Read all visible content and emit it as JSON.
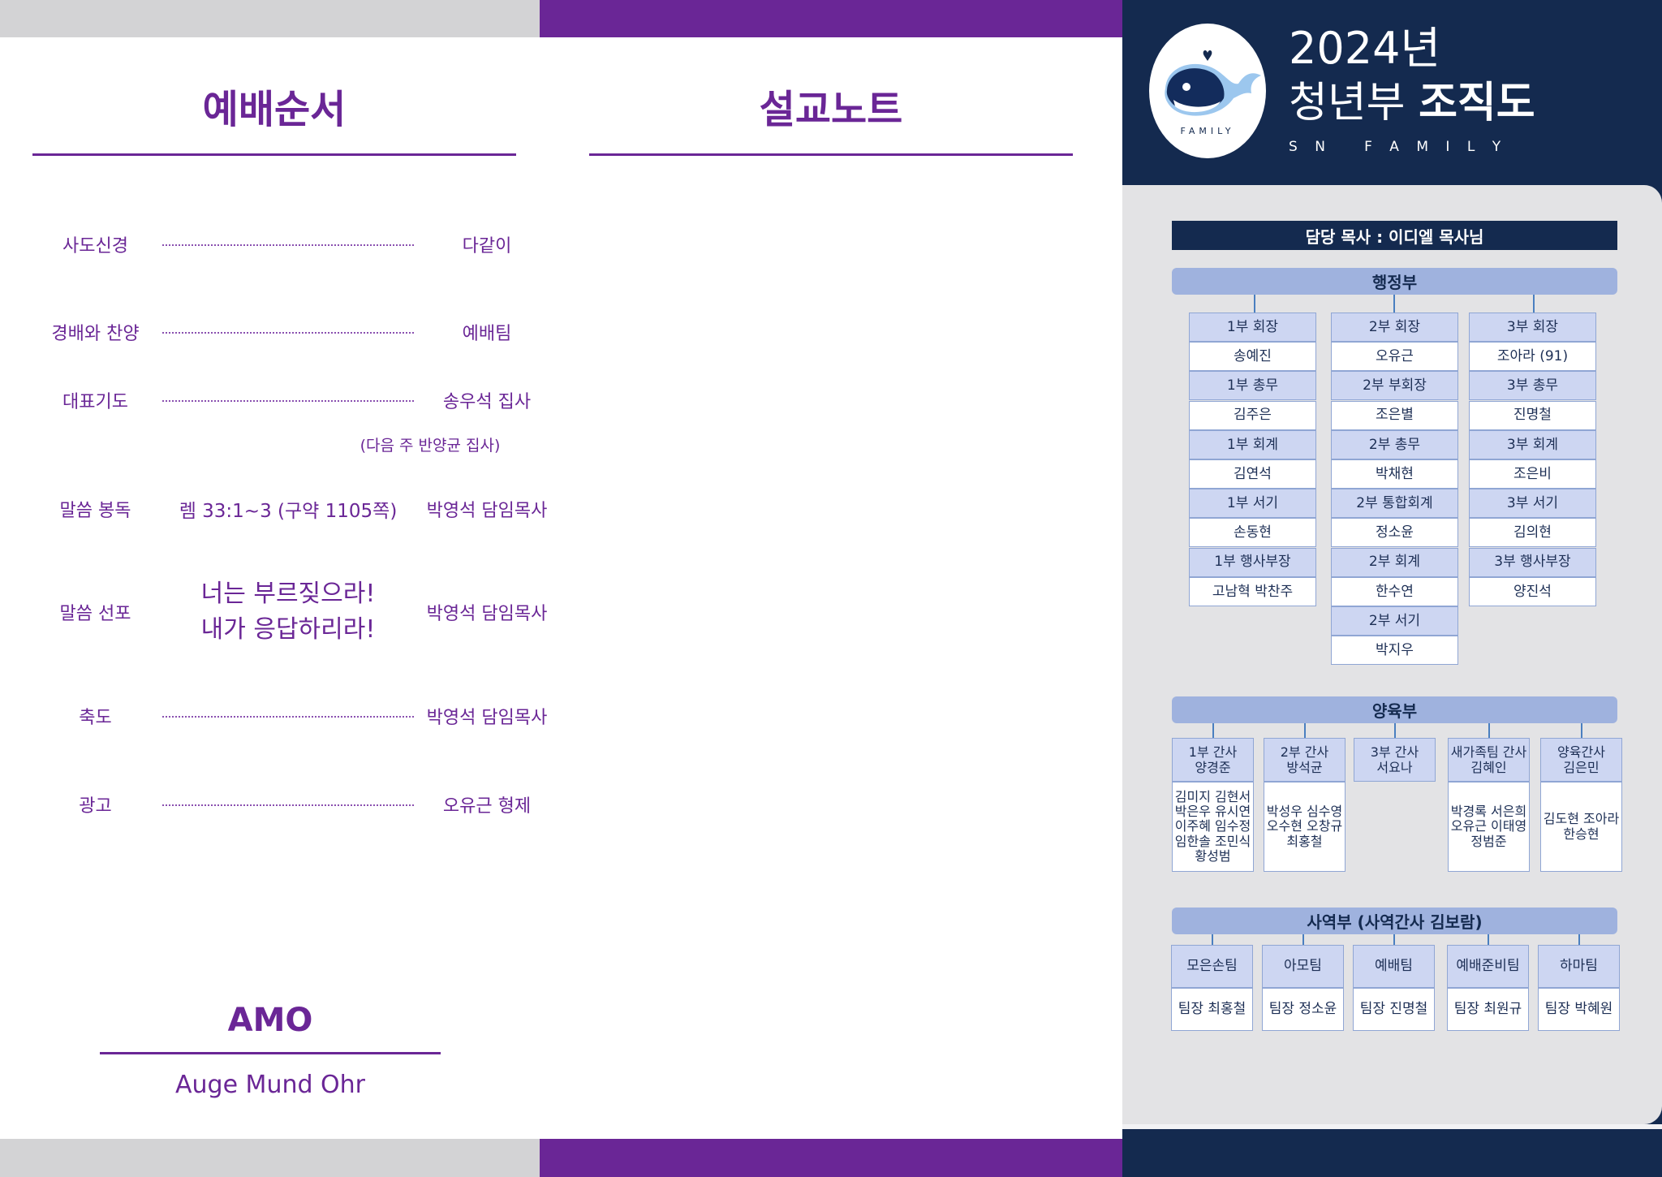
{
  "left": {
    "title": "예배순서",
    "items": [
      {
        "label": "사도신경",
        "right": "다같이"
      },
      {
        "label": "경배와 찬양",
        "right": "예배팀"
      },
      {
        "label": "대표기도",
        "right": "송우석 집사",
        "note": "(다음 주 반양균 집사)"
      },
      {
        "label": "말씀 봉독",
        "middle": "렘 33:1~3 (구약 1105쪽)",
        "right": "박영석 담임목사"
      },
      {
        "label": "말씀 선포",
        "middle_line1": "너는 부르짖으라!",
        "middle_line2": "내가 응답하리라!",
        "right": "박영석 담임목사"
      },
      {
        "label": "축도",
        "right": "박영석 담임목사"
      },
      {
        "label": "광고",
        "right": "오유근 형제"
      }
    ],
    "footer": {
      "title": "AMO",
      "subtitle": "Auge Mund Ohr"
    }
  },
  "middle": {
    "title": "설교노트"
  },
  "right": {
    "logo_text": "FAMILY",
    "header_year": "2024년",
    "header_line2_a": "청년부 ",
    "header_line2_b": "조직도",
    "header_sub": "S N   F A M I L Y",
    "pastor": "담당 목사 : 이디엘 목사님",
    "admin": {
      "title": "행정부",
      "col1": [
        "1부 회장",
        "송예진",
        "1부 총무",
        "김주은",
        "1부 회계",
        "김연석",
        "1부 서기",
        "손동현",
        "1부 행사부장",
        "고남혁 박찬주"
      ],
      "col2": [
        "2부 회장",
        "오유근",
        "2부 부회장",
        "조은별",
        "2부 총무",
        "박채현",
        "2부 통합회계",
        "정소윤",
        "2부 회계",
        "한수연",
        "2부 서기",
        "박지우"
      ],
      "col3": [
        "3부 회장",
        "조아라 (91)",
        "3부 총무",
        "진명철",
        "3부 회계",
        "조은비",
        "3부 서기",
        "김의현",
        "3부 행사부장",
        "양진석"
      ]
    },
    "nurture": {
      "title": "양육부",
      "groups": [
        {
          "head1": "1부 간사",
          "head2": "양경준",
          "members": [
            "김미지 김현서",
            "박은우 유시연",
            "이주혜 임수정",
            "임한솔 조민식",
            "황성범"
          ]
        },
        {
          "head1": "2부 간사",
          "head2": "방석균",
          "members": [
            "박성우 심수영",
            "오수현 오창규",
            "최홍철"
          ]
        },
        {
          "head1": "3부 간사",
          "head2": "서요나",
          "members": []
        },
        {
          "head1": "새가족팀 간사",
          "head2": "김혜인",
          "members": [
            "박경록 서은희",
            "오유근 이태영",
            "정범준"
          ]
        },
        {
          "head1": "양육간사",
          "head2": "김은민",
          "members": [
            "김도현 조아라",
            "한승현"
          ]
        }
      ]
    },
    "ministry": {
      "title": "사역부 (사역간사 김보람)",
      "teams": [
        {
          "name": "모은손팀",
          "leader": "팀장 최홍철"
        },
        {
          "name": "아모팀",
          "leader": "팀장 정소윤"
        },
        {
          "name": "예배팀",
          "leader": "팀장 진명철"
        },
        {
          "name": "예배준비팀",
          "leader": "팀장 최원규"
        },
        {
          "name": "하마팀",
          "leader": "팀장 박혜원"
        }
      ]
    }
  }
}
